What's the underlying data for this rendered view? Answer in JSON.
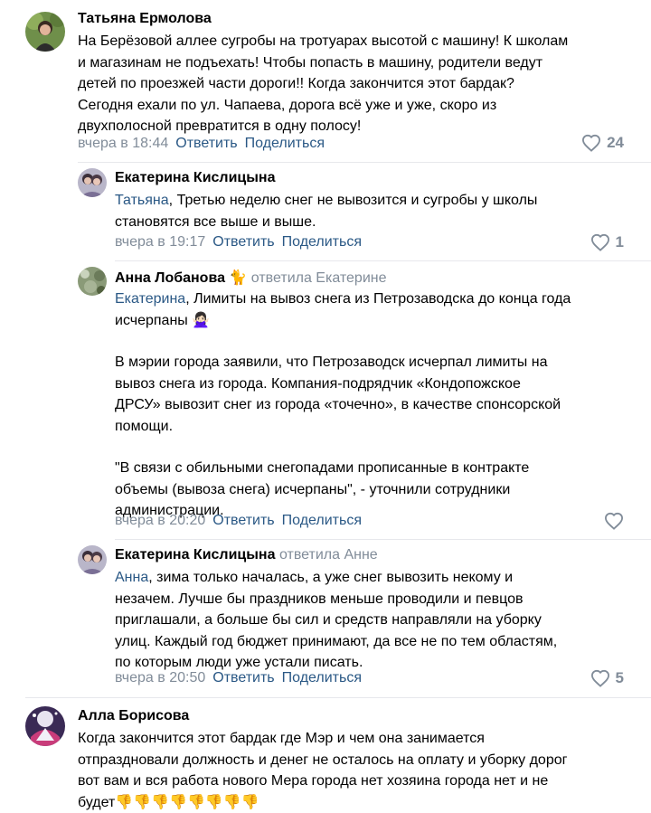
{
  "comments": [
    {
      "author": "Татьяна Ермолова",
      "text_lines": [
        "На Берёзовой аллее сугробы на тротуарах высотой с машину! К школам",
        "и магазинам не подъехать! Чтобы попасть в машину, родители ведут",
        "детей по проезжей части дороги!! Когда закончится этот бардак?",
        "Сегодня ехали по ул. Чапаева, дорога всё уже и уже, скоро из",
        "двухполосной превратится в одну полосу!"
      ],
      "time": "вчера в 18:44",
      "reply_label": "Ответить",
      "share_label": "Поделиться",
      "likes": "24"
    },
    {
      "author": "Екатерина Кислицына",
      "mention": "Татьяна",
      "text_first": ", Третью неделю снег не вывозится и сугробы у школы",
      "text_rest": [
        "становятся все выше и выше."
      ],
      "time": "вчера в 19:17",
      "reply_label": "Ответить",
      "share_label": "Поделиться",
      "likes": "1"
    },
    {
      "author": "Анна Лобанова",
      "author_emoji": "🐈",
      "replied_to": "ответила Екатерине",
      "mention": "Екатерина",
      "text_first": ", Лимиты на вывоз снега из Петрозаводска до конца года",
      "text_second": "исчерпаны 🙅🏻‍♀️",
      "para2": [
        "В мэрии города заявили, что Петрозаводск исчерпал лимиты на",
        "вывоз снега из города. Компания-подрядчик «Кондопожское",
        "ДРСУ» вывозит снег из города «точечно», в качестве спонсорской",
        "помощи."
      ],
      "para3": [
        "\"В связи с обильными снегопадами прописанные в контракте",
        "объемы (вывоза снега) исчерпаны\", - уточнили сотрудники",
        "администрации."
      ],
      "time": "вчера в 20:20",
      "reply_label": "Ответить",
      "share_label": "Поделиться"
    },
    {
      "author": "Екатерина Кислицына",
      "replied_to": "ответила Анне",
      "mention": "Анна",
      "text_first": ", зима только началась, а уже снег вывозить некому и",
      "text_rest": [
        "незачем. Лучше бы праздников меньше проводили и певцов",
        "приглашали, а больше бы сил и средств направляли на уборку",
        "улиц. Каждый год бюджет принимают, да все не по тем областям,",
        "по которым люди уже устали писать."
      ],
      "time": "вчера в 20:50",
      "reply_label": "Ответить",
      "share_label": "Поделиться",
      "likes": "5"
    },
    {
      "author": "Алла Борисова",
      "text_lines": [
        "Когда закончится этот бардак где Мэр и чем она занимается",
        "отпраздновали должность и денег не осталось на оплату и уборку дорог",
        "вот вам и вся работа нового Мера города нет хозяина города нет и не",
        "будет👎👎👎👎👎👎👎👎"
      ]
    }
  ],
  "colors": {
    "link": "#2a5885",
    "meta": "#818c99",
    "divider": "#e7e8ec"
  },
  "icons": [
    "heart-icon"
  ]
}
